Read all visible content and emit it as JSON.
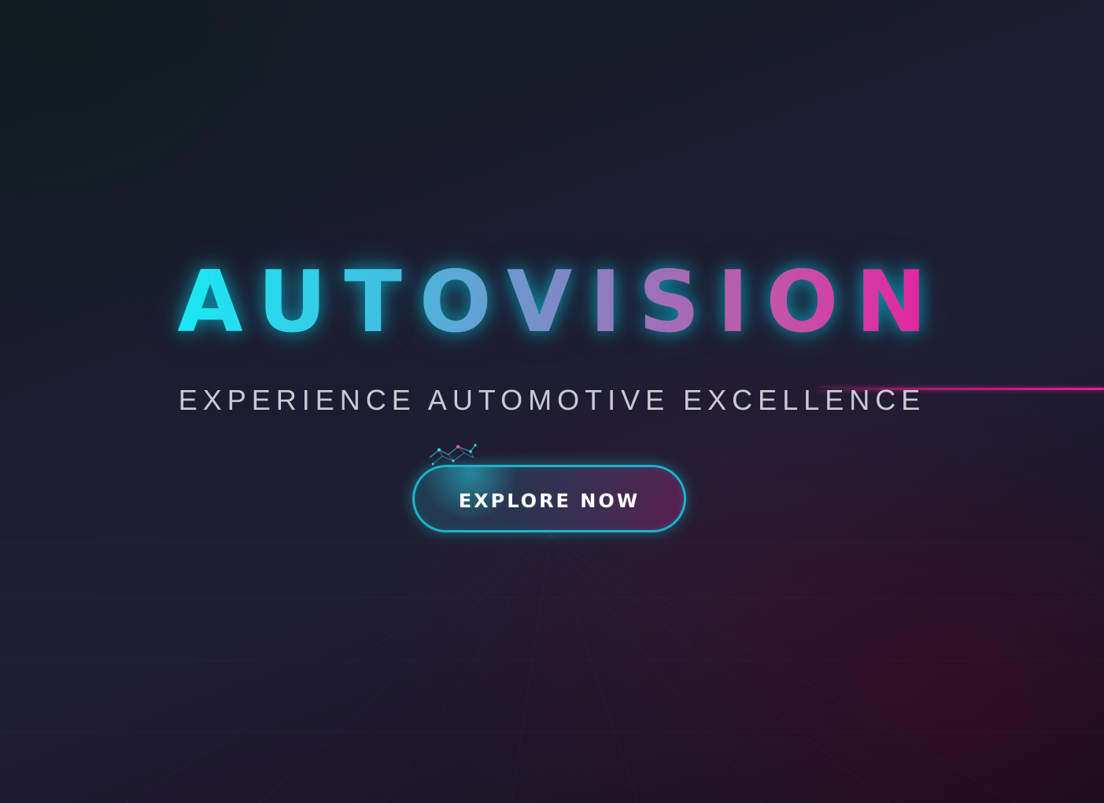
{
  "hero": {
    "title": "AUTOVISION",
    "tagline": "EXPERIENCE AUTOMOTIVE EXCELLENCE",
    "cta_label": "EXPLORE NOW"
  },
  "colors": {
    "background": "#1c1d30",
    "title_gradient_start": "#16ecf5",
    "title_gradient_end": "#e6209e",
    "tagline": "#c8cbd4",
    "button_border": "#1bb3c8",
    "accent_line": "#e61e96"
  },
  "icons": {
    "sparkle": "sparkle-icon"
  }
}
